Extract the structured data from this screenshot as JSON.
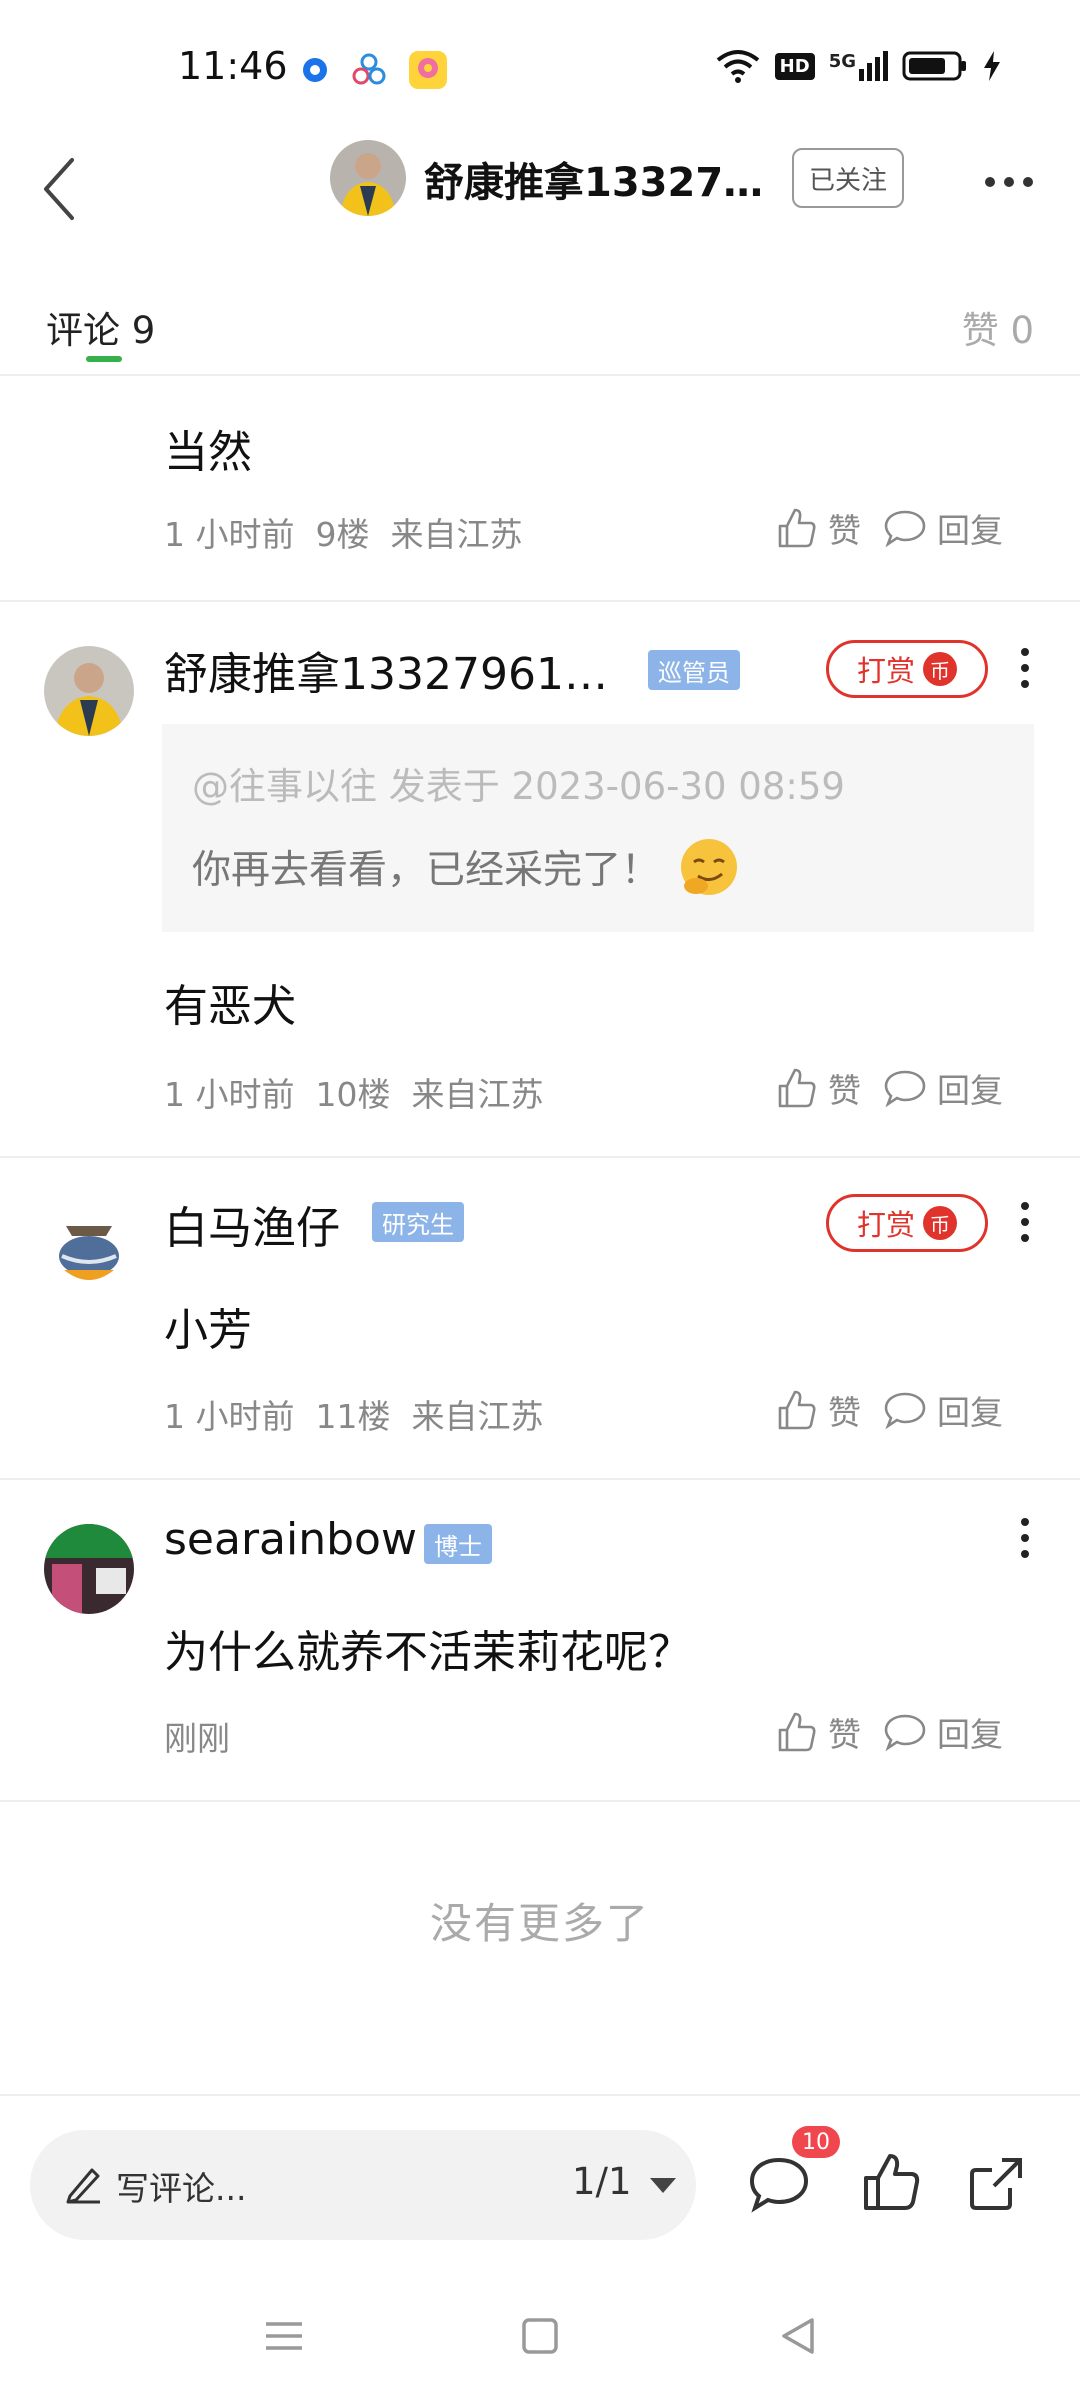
{
  "status_bar": {
    "time": "11:46",
    "hd": "HD",
    "network": "5G"
  },
  "header": {
    "title": "舒康推拿13327…",
    "follow_label": "已关注"
  },
  "tabs": {
    "comments_label": "评论",
    "comments_count": "9",
    "likes_label": "赞",
    "likes_count": "0"
  },
  "comments": [
    {
      "text": "当然",
      "time": "1 小时前",
      "floor": "9楼",
      "location": "来自江苏"
    },
    {
      "name": "舒康推拿13327961…",
      "badge": "巡管员",
      "reward_label": "打赏",
      "quote_header": "@往事以往 发表于 2023-06-30 08:59",
      "quote_text": "你再去看看，已经采完了！",
      "text": "有恶犬",
      "time": "1 小时前",
      "floor": "10楼",
      "location": "来自江苏"
    },
    {
      "name": "白马渔仔",
      "badge": "研究生",
      "reward_label": "打赏",
      "text": "小芳",
      "time": "1 小时前",
      "floor": "11楼",
      "location": "来自江苏"
    },
    {
      "name": "searainbow",
      "badge": "博士",
      "text": "为什么就养不活茉莉花呢？",
      "time": "刚刚"
    }
  ],
  "actions": {
    "like_label": "赞",
    "reply_label": "回复"
  },
  "reward_coin": "币",
  "no_more": "没有更多了",
  "bottom_bar": {
    "placeholder": "写评论...",
    "page": "1/1",
    "comment_badge": "10"
  },
  "colors": {
    "accent_green": "#35b04a",
    "reward_red": "#e0332b",
    "badge_blue": "#8db4e8",
    "notify_red": "#f0474e"
  }
}
